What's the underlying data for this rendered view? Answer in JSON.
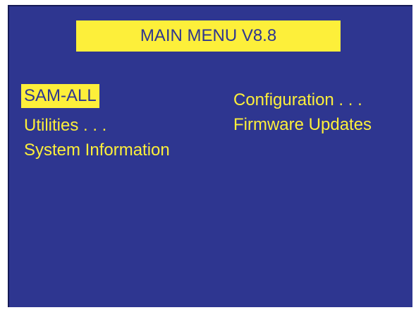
{
  "title": "MAIN MENU V8.8",
  "menu": {
    "left": [
      {
        "label": "SAM-ALL",
        "selected": true
      },
      {
        "label": "Utilities . . .",
        "selected": false
      },
      {
        "label": "System Information",
        "selected": false
      }
    ],
    "right": [
      {
        "label": "Configuration . . .",
        "selected": false
      },
      {
        "label": "Firmware Updates",
        "selected": false
      }
    ]
  },
  "colors": {
    "background": "#2e3690",
    "highlight": "#fdef3a",
    "frame": "#151a55"
  }
}
